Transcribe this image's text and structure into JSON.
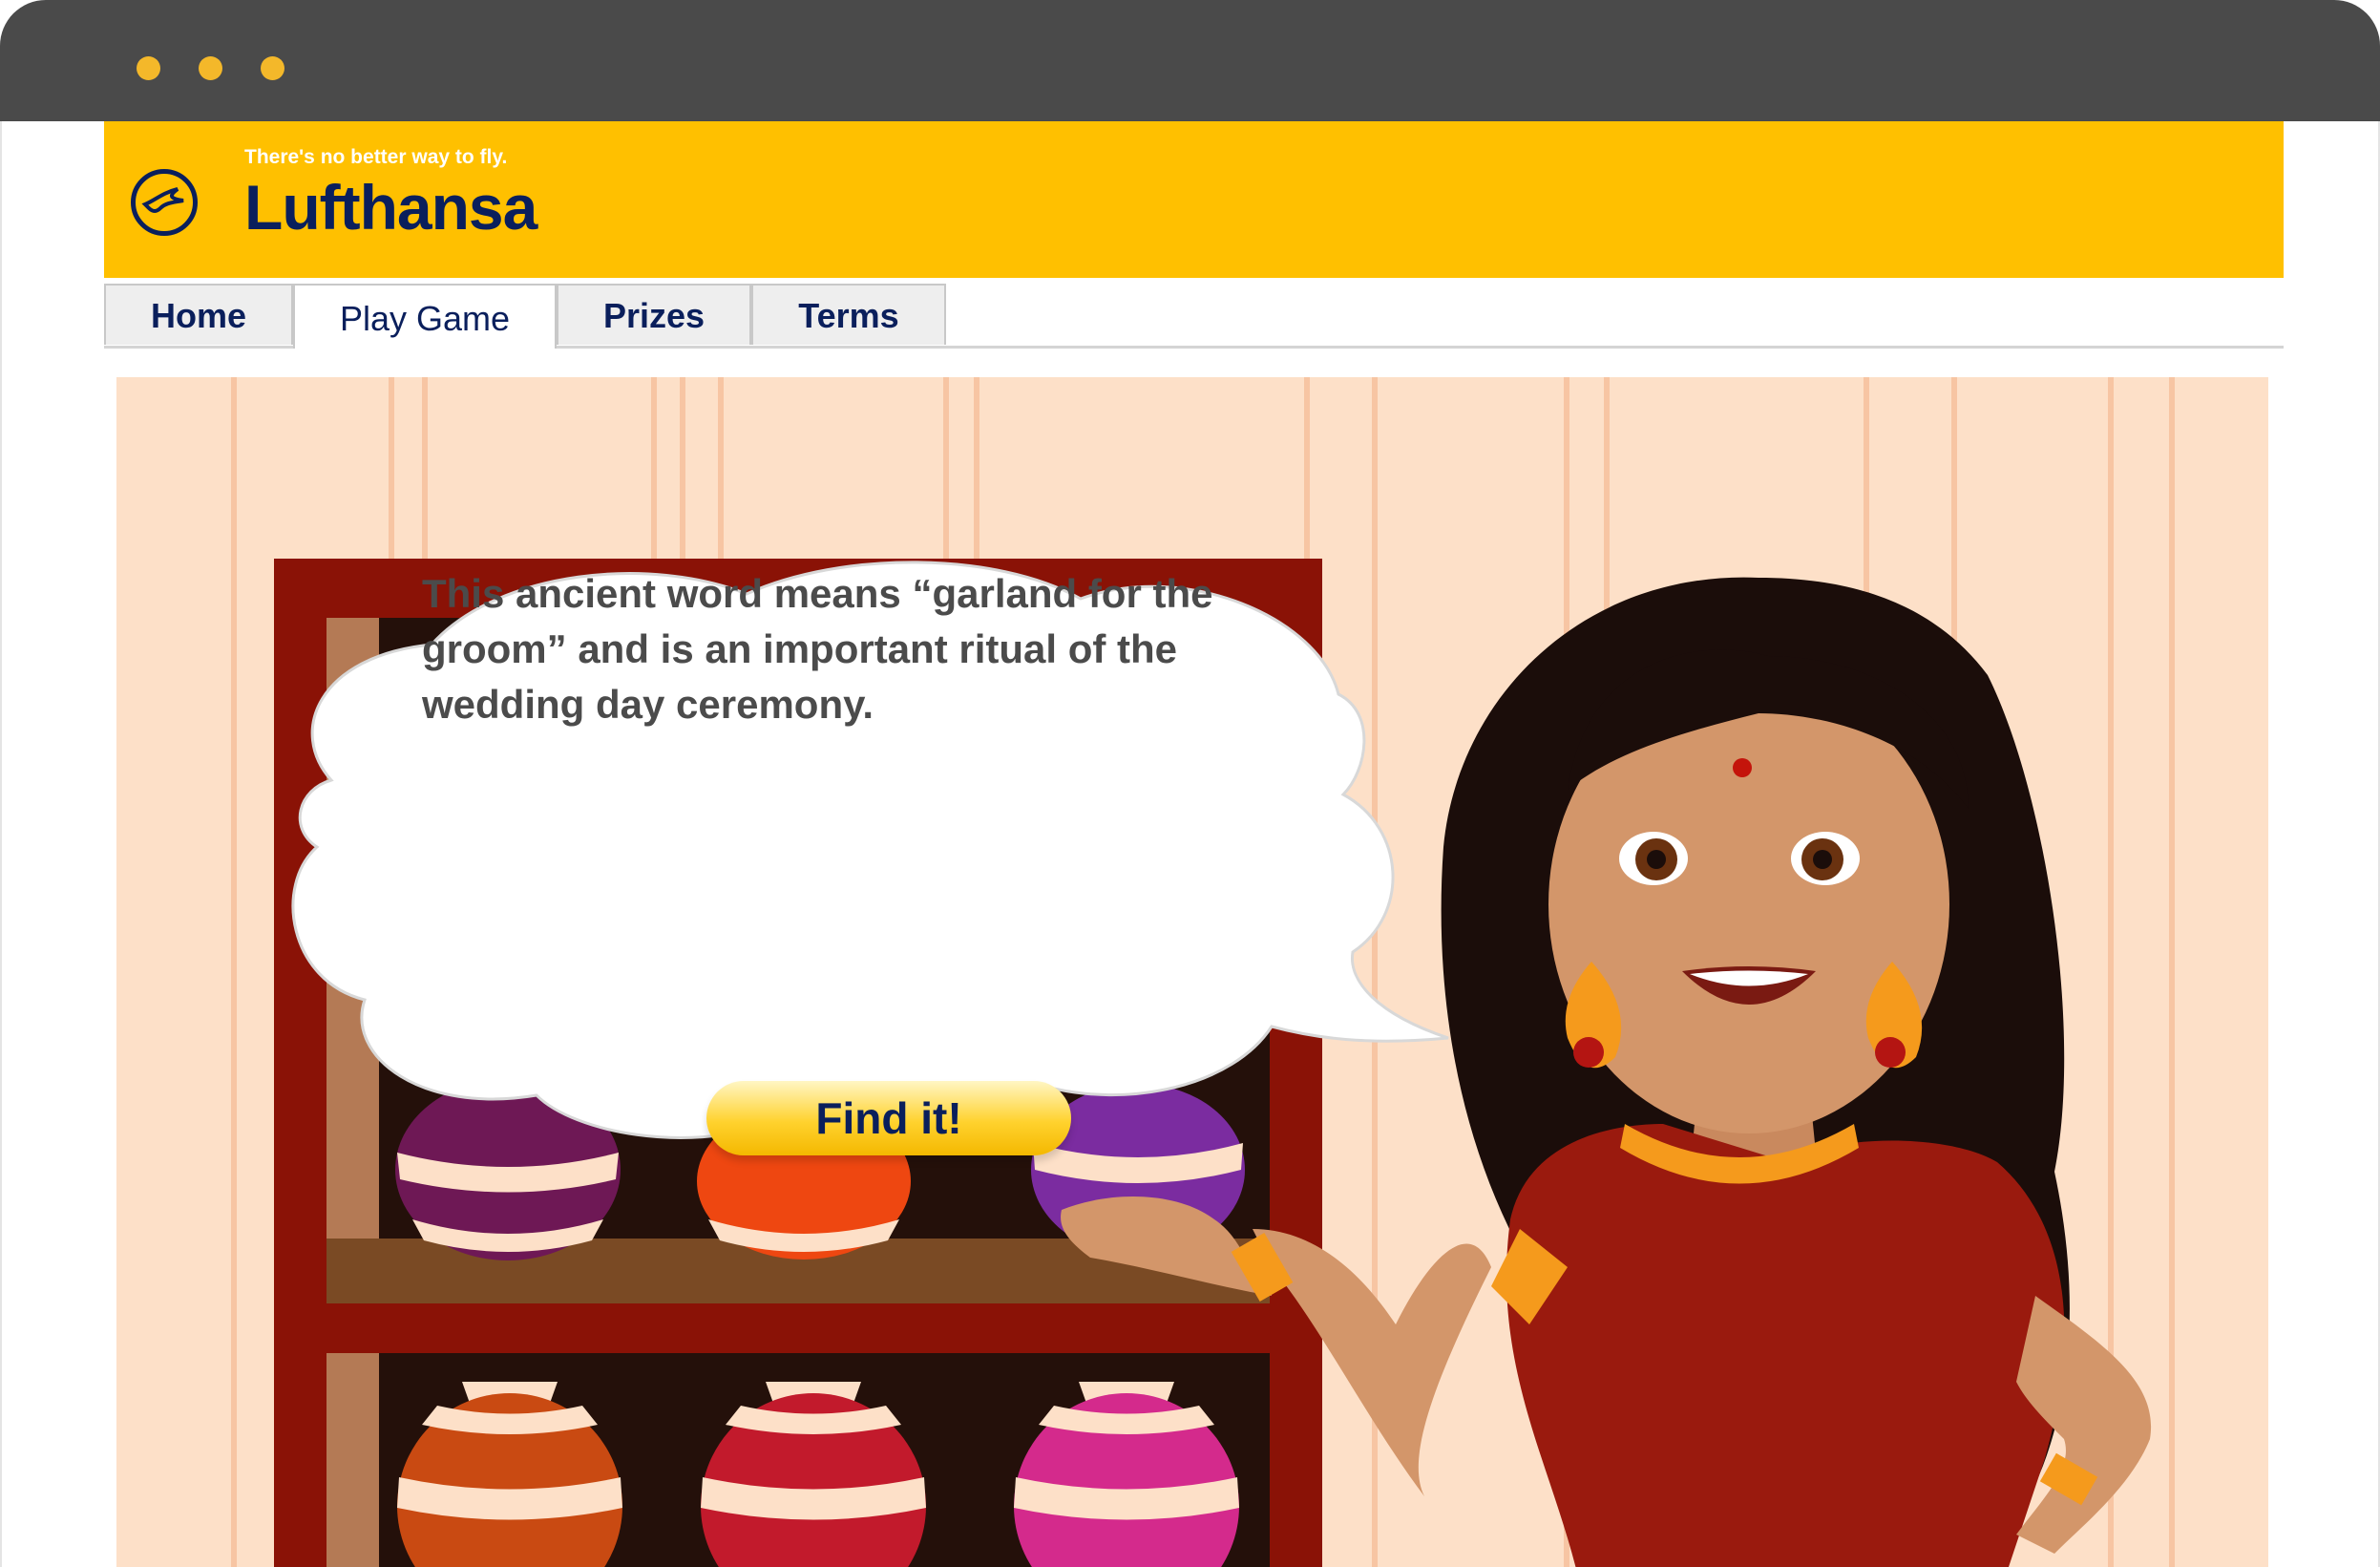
{
  "browser": {
    "dots": [
      "yellow",
      "yellow",
      "yellow"
    ]
  },
  "header": {
    "tagline": "There's no better way to fly.",
    "brand": "Lufthansa",
    "background": "#ffc000",
    "brand_color": "#0a1f5c"
  },
  "nav": {
    "tabs": [
      {
        "label": "Home",
        "active": false
      },
      {
        "label": "Play Game",
        "active": true
      },
      {
        "label": "Prizes",
        "active": false
      },
      {
        "label": "Terms",
        "active": false
      }
    ]
  },
  "game": {
    "question": "This ancient word means “garland for the groom” and is an important ritual of the wedding day ceremony.",
    "action_label": "Find it!"
  }
}
